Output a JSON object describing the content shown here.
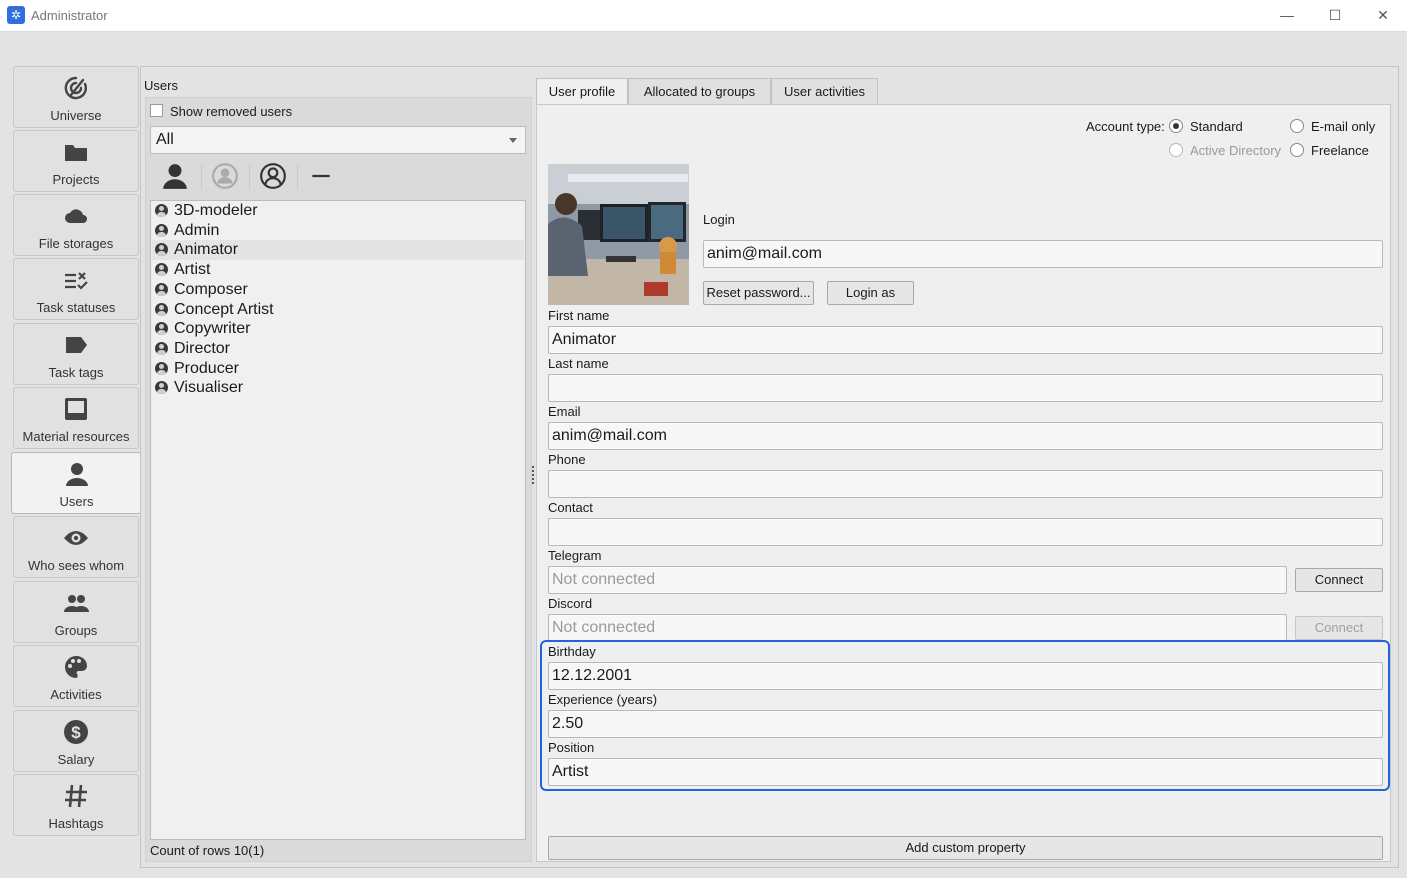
{
  "window": {
    "title": "Administrator",
    "minimize_glyph": "—",
    "maximize_glyph": "☐",
    "close_glyph": "✕"
  },
  "nav": {
    "items": [
      {
        "label": "Universe",
        "icon": "universe-icon"
      },
      {
        "label": "Projects",
        "icon": "folder-icon"
      },
      {
        "label": "File storages",
        "icon": "cloud-icon"
      },
      {
        "label": "Task statuses",
        "icon": "task-statuses-icon"
      },
      {
        "label": "Task tags",
        "icon": "tag-icon"
      },
      {
        "label": "Material resources",
        "icon": "inbox-icon"
      },
      {
        "label": "Users",
        "icon": "user-icon",
        "active": true
      },
      {
        "label": "Who sees whom",
        "icon": "eye-icon"
      },
      {
        "label": "Groups",
        "icon": "groups-icon"
      },
      {
        "label": "Activities",
        "icon": "palette-icon"
      },
      {
        "label": "Salary",
        "icon": "dollar-icon"
      },
      {
        "label": "Hashtags",
        "icon": "hashtag-icon"
      }
    ]
  },
  "users_panel": {
    "title": "Users",
    "show_removed_label": "Show removed users",
    "show_removed_checked": false,
    "filter_value": "All",
    "toolbar": [
      "add-user-icon",
      "user-circle-icon",
      "user-outline-icon",
      "remove-icon"
    ],
    "users": [
      "3D-modeler",
      "Admin",
      "Animator",
      "Artist",
      "Composer",
      "Concept Artist",
      "Copywriter",
      "Director",
      "Producer",
      "Visualiser"
    ],
    "selected": "Animator",
    "count_text": "Count of rows 10(1)"
  },
  "tabs": [
    {
      "label": "User profile",
      "active": true
    },
    {
      "label": "Allocated to groups",
      "active": false
    },
    {
      "label": "User activities",
      "active": false
    }
  ],
  "profile": {
    "account_type_label": "Account type:",
    "account_types": {
      "standard": "Standard",
      "email_only": "E-mail only",
      "active_directory": "Active Directory",
      "freelance": "Freelance"
    },
    "account_type_selected": "Standard",
    "login_label": "Login",
    "login_value": "anim@mail.com",
    "reset_password_label": "Reset password...",
    "login_as_label": "Login as",
    "first_name_label": "First name",
    "first_name_value": "Animator",
    "last_name_label": "Last name",
    "last_name_value": "",
    "email_label": "Email",
    "email_value": "anim@mail.com",
    "phone_label": "Phone",
    "phone_value": "",
    "contact_label": "Contact",
    "contact_value": "",
    "telegram_label": "Telegram",
    "telegram_value": "Not connected",
    "telegram_connect_label": "Connect",
    "discord_label": "Discord",
    "discord_value": "Not connected",
    "discord_connect_label": "Connect",
    "birthday_label": "Birthday",
    "birthday_value": "12.12.2001",
    "experience_label": "Experience (years)",
    "experience_value": "2.50",
    "position_label": "Position",
    "position_value": "Artist",
    "add_custom_property_label": "Add custom property"
  },
  "colors": {
    "highlight": "#2462e0",
    "app_icon": "#2f6fe0"
  }
}
